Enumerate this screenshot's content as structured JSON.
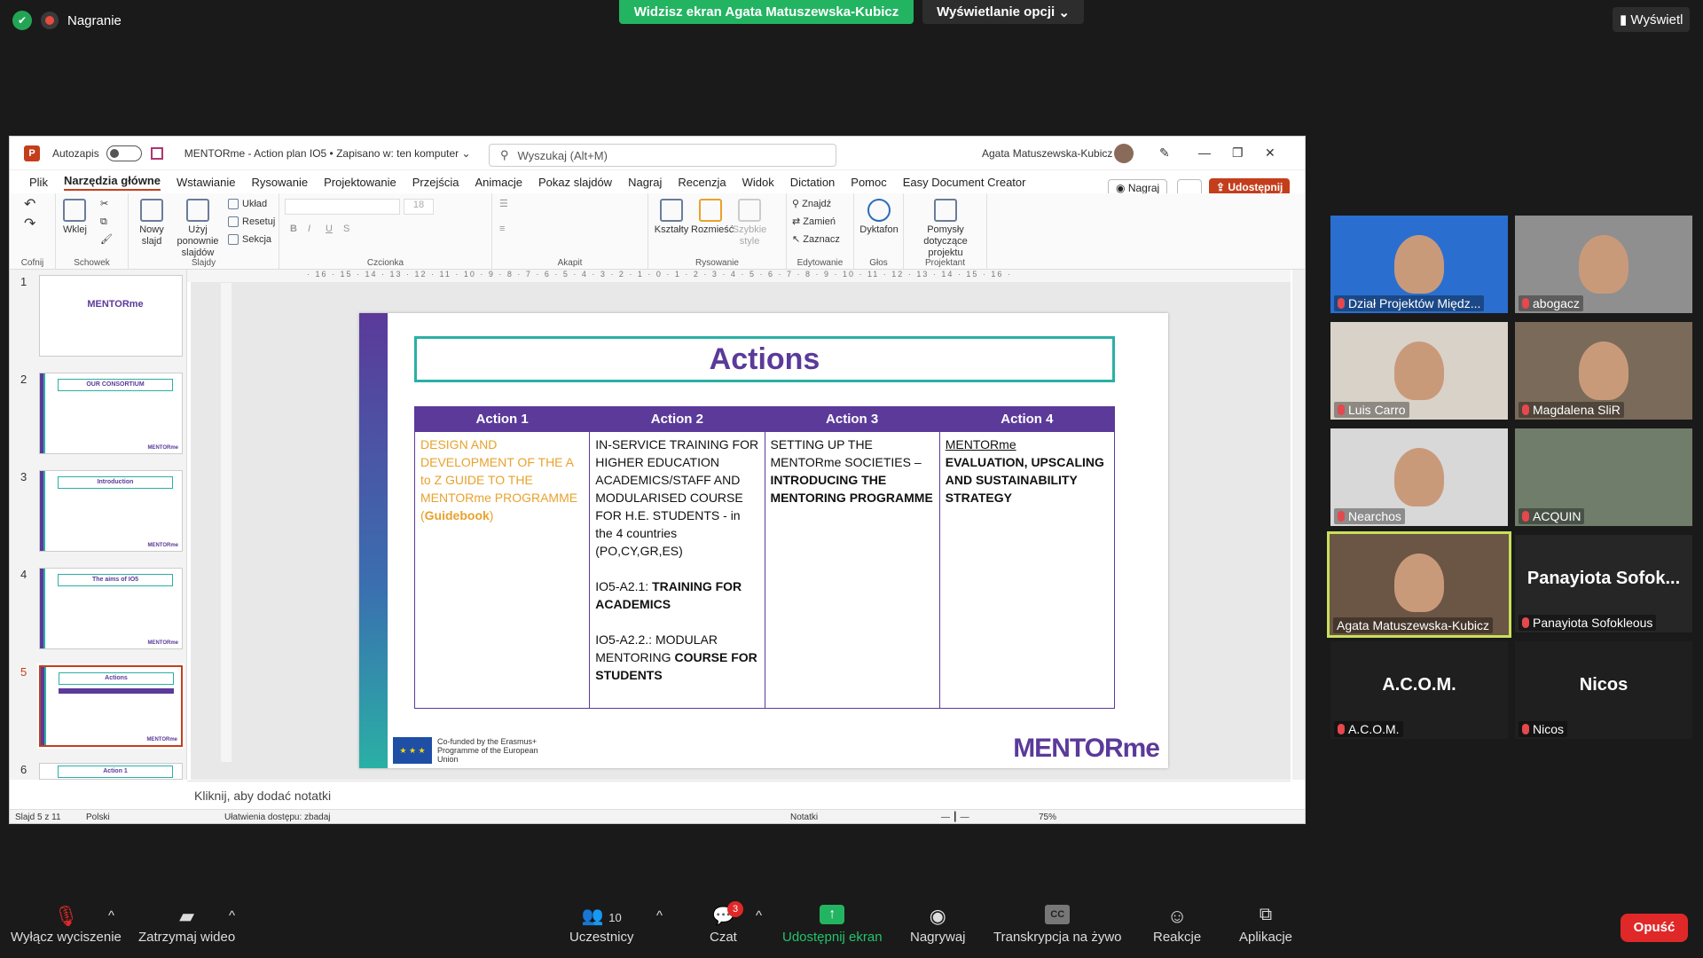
{
  "zoom": {
    "recording_label": "Nagranie",
    "share_banner": "Widzisz ekran Agata Matuszewska-Kubicz",
    "view_options": "Wyświetlanie opcji",
    "view_button": "Wyświetl",
    "participants_count": "10",
    "chat_badge": "3",
    "bottom": {
      "mute": "Wyłącz wyciszenie",
      "video": "Zatrzymaj wideo",
      "participants": "Uczestnicy",
      "chat": "Czat",
      "share": "Udostępnij ekran",
      "record": "Nagrywaj",
      "transcript": "Transkrypcja na żywo",
      "reactions": "Reakcje",
      "apps": "Aplikacje",
      "leave": "Opuść"
    },
    "tiles": [
      {
        "name": "Dział Projektów Międz..."
      },
      {
        "name": "abogacz"
      },
      {
        "name": "Luis Carro"
      },
      {
        "name": "Magdalena SliR"
      },
      {
        "name": "Nearchos"
      },
      {
        "name": "ACQUIN"
      },
      {
        "name": "Agata Matuszewska-Kubicz"
      },
      {
        "name": "Panayiota Sofokleous",
        "big": "Panayiota Sofok..."
      },
      {
        "name": "A.C.O.M.",
        "big": "A.C.O.M."
      },
      {
        "name": "Nicos",
        "big": "Nicos"
      }
    ]
  },
  "ppt": {
    "autosave": "Autozapis",
    "doc_title": "MENTORme - Action plan IO5 • Zapisano w: ten komputer",
    "search_placeholder": "Wyszukaj (Alt+M)",
    "user": "Agata Matuszewska-Kubicz",
    "menu": [
      "Plik",
      "Narzędzia główne",
      "Wstawianie",
      "Rysowanie",
      "Projektowanie",
      "Przejścia",
      "Animacje",
      "Pokaz slajdów",
      "Nagraj",
      "Recenzja",
      "Widok",
      "Dictation",
      "Pomoc",
      "Easy Document Creator"
    ],
    "nagraj": "Nagraj",
    "udostepnij": "Udostępnij",
    "ribbon": {
      "cofnij": "Cofnij",
      "wklej": "Wklej",
      "schowek": "Schowek",
      "nowy_slajd": "Nowy slajd",
      "uzyj": "Użyj ponownie slajdów",
      "uklad": "Układ",
      "resetuj": "Resetuj",
      "sekcja": "Sekcja",
      "slajdy": "Slajdy",
      "font_size": "18",
      "czcionka": "Czcionka",
      "akapit": "Akapit",
      "ksztalty": "Kształty",
      "rozmiesc": "Rozmieść",
      "szybkie": "Szybkie style",
      "rysowanie": "Rysowanie",
      "znajdz": "Znajdź",
      "zamien": "Zamień",
      "zaznacz": "Zaznacz",
      "edytowanie": "Edytowanie",
      "dyktafon": "Dyktafon",
      "glos": "Głos",
      "pomysly": "Pomysły dotyczące projektu",
      "projektant": "Projektant"
    },
    "thumbs": [
      {
        "num": "1",
        "title": "MENTORme"
      },
      {
        "num": "2",
        "title": "OUR CONSORTIUM"
      },
      {
        "num": "3",
        "title": "Introduction"
      },
      {
        "num": "4",
        "title": "The aims of IO5"
      },
      {
        "num": "5",
        "title": "Actions"
      },
      {
        "num": "6",
        "title": "Action 1"
      }
    ],
    "ruler": "· 16 · 15 · 14 · 13 · 12 · 11 · 10 · 9 · 8 · 7 · 6 · 5 · 4 · 3 · 2 · 1 · 0 · 1 · 2 · 3 · 4 · 5 · 6 · 7 · 8 · 9 · 10 · 11 · 12 · 13 · 14 · 15 · 16 ·",
    "slide": {
      "title": "Actions",
      "headers": [
        "Action 1",
        "Action 2",
        "Action 3",
        "Action 4"
      ],
      "col1": "DESIGN AND DEVELOPMENT OF THE A to Z GUIDE TO THE MENTORme PROGRAMME (",
      "col1_bold": "Guidebook",
      "col1_end": ")",
      "col2_a": "IN-SERVICE TRAINING FOR HIGHER EDUCATION ACADEMICS/STAFF AND MODULARISED COURSE FOR H.E. STUDENTS - in the 4 countries (PO,CY,GR,ES)",
      "col2_b1": "IO5-A2.1: ",
      "col2_b2": "TRAINING FOR ACADEMICS",
      "col2_c1": "IO5-A2.2.: MODULAR MENTORING ",
      "col2_c2": "COURSE FOR STUDENTS",
      "col3_a": "SETTING UP THE MENTORme SOCIETIES – ",
      "col3_b": "INTRODUCING THE MENTORING PROGRAMME",
      "col4_a": "MENTORme",
      "col4_b": "EVALUATION, UPSCALING AND SUSTAINABILITY STRATEGY",
      "eu_text": "Co-funded by the Erasmus+ Programme of the European Union",
      "logo": "MENTORme"
    },
    "notes": "Kliknij, aby dodać notatki",
    "status": {
      "slide": "Slajd 5 z 11",
      "lang": "Polski",
      "access": "Ułatwienia dostępu: zbadaj",
      "notes": "Notatki",
      "zoom": "75%"
    }
  }
}
